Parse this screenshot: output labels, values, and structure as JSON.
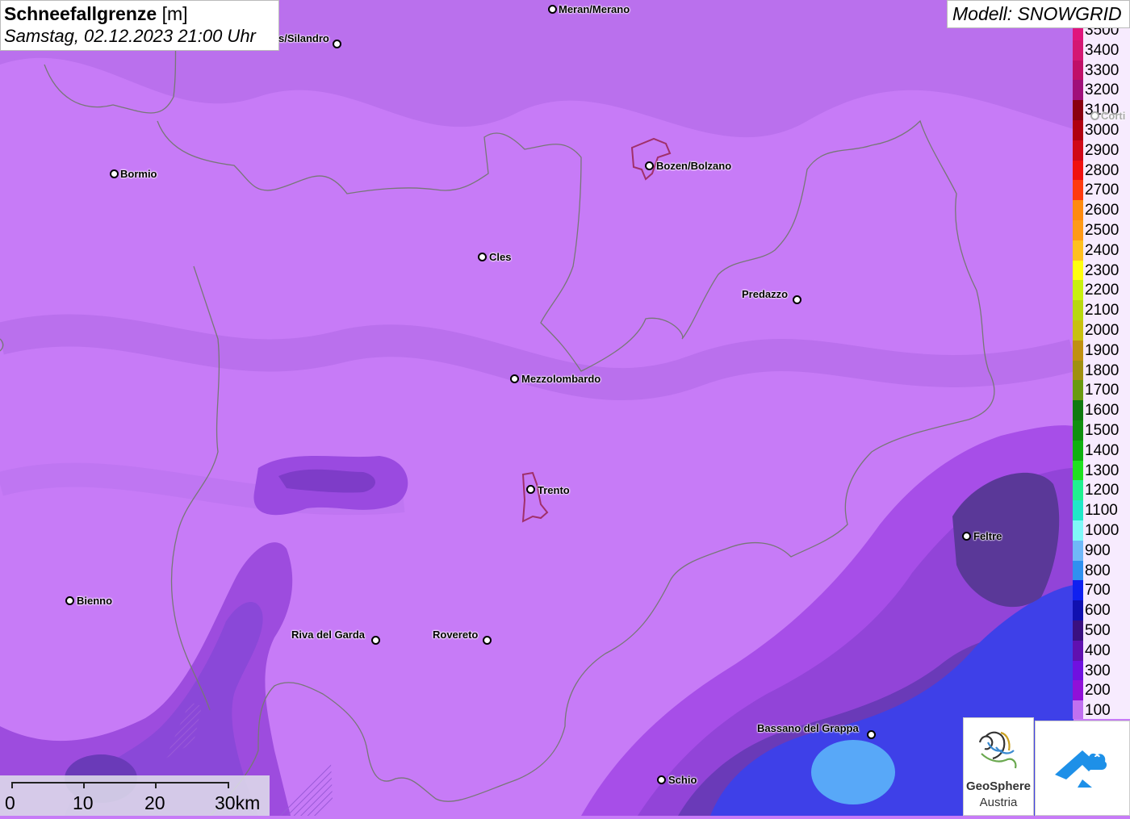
{
  "title": {
    "main": "Schneefallgrenze",
    "unit": "[m]",
    "datetime": "Samstag, 02.12.2023 21:00 Uhr"
  },
  "model": "Modell: SNOWGRID",
  "legend": [
    {
      "label": "3500",
      "color": "#e0157d"
    },
    {
      "label": "3400",
      "color": "#d41773"
    },
    {
      "label": "3300",
      "color": "#c01068"
    },
    {
      "label": "3200",
      "color": "#a0107a"
    },
    {
      "label": "3100",
      "color": "#8a0010"
    },
    {
      "label": "3000",
      "color": "#b00010"
    },
    {
      "label": "2900",
      "color": "#d00818"
    },
    {
      "label": "2800",
      "color": "#f01010"
    },
    {
      "label": "2700",
      "color": "#ff3a10"
    },
    {
      "label": "2600",
      "color": "#ff8a10"
    },
    {
      "label": "2500",
      "color": "#ff9a18"
    },
    {
      "label": "2400",
      "color": "#ffc020"
    },
    {
      "label": "2300",
      "color": "#ffff10"
    },
    {
      "label": "2200",
      "color": "#c8f010"
    },
    {
      "label": "2100",
      "color": "#b8d810"
    },
    {
      "label": "2000",
      "color": "#c8c010"
    },
    {
      "label": "1900",
      "color": "#c09010"
    },
    {
      "label": "1800",
      "color": "#a09010"
    },
    {
      "label": "1700",
      "color": "#6a9a10"
    },
    {
      "label": "1600",
      "color": "#107a10"
    },
    {
      "label": "1500",
      "color": "#109010"
    },
    {
      "label": "1400",
      "color": "#10b010"
    },
    {
      "label": "1300",
      "color": "#20e020"
    },
    {
      "label": "1200",
      "color": "#20f090"
    },
    {
      "label": "1100",
      "color": "#20e8c8"
    },
    {
      "label": "1000",
      "color": "#80f8f8"
    },
    {
      "label": "900",
      "color": "#70b8f8"
    },
    {
      "label": "800",
      "color": "#3090f0"
    },
    {
      "label": "700",
      "color": "#1020f0"
    },
    {
      "label": "600",
      "color": "#1010b0"
    },
    {
      "label": "500",
      "color": "#3a1080"
    },
    {
      "label": "400",
      "color": "#6010b0"
    },
    {
      "label": "300",
      "color": "#7010e0"
    },
    {
      "label": "200",
      "color": "#9010d8"
    },
    {
      "label": "100",
      "color": "#c070f0"
    }
  ],
  "cities": [
    {
      "name": "Meran/Merano"
    },
    {
      "name": "s/Silandro"
    },
    {
      "name": "Bormio"
    },
    {
      "name": "Bozen/Bolzano"
    },
    {
      "name": "Cles"
    },
    {
      "name": "Predazzo"
    },
    {
      "name": "Mezzolombardo"
    },
    {
      "name": "Trento"
    },
    {
      "name": "Feltre"
    },
    {
      "name": "Bienno"
    },
    {
      "name": "Riva del Garda"
    },
    {
      "name": "Rovereto"
    },
    {
      "name": "Bassano del Grappa"
    },
    {
      "name": "Schio"
    },
    {
      "name": "Corti"
    }
  ],
  "scale": {
    "labels": [
      "0",
      "10",
      "20",
      "30km"
    ]
  },
  "logos": {
    "geosphere_line1": "GeoSphere",
    "geosphere_line2": "Austria"
  }
}
